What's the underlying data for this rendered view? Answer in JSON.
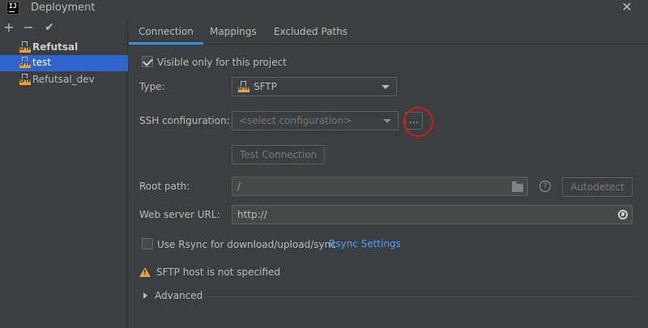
{
  "window": {
    "title": "Deployment",
    "logo_text": "IJ"
  },
  "toolbar": {
    "add": "+",
    "remove": "−",
    "check": "✔"
  },
  "tree": {
    "items": [
      {
        "label": "Refutsal",
        "bold": true,
        "icon_text": "SFTP"
      },
      {
        "label": "test",
        "selected": true,
        "icon_text": "SFTP"
      },
      {
        "label": "Refutsal_dev",
        "icon_text": "SFTP"
      }
    ]
  },
  "tabs": [
    {
      "label": "Connection",
      "active": true
    },
    {
      "label": "Mappings"
    },
    {
      "label": "Excluded Paths"
    }
  ],
  "connection": {
    "visible_only_label": "Visible only for this project",
    "visible_only_checked": true,
    "type_label": "Type:",
    "type_value": "SFTP",
    "type_icon_text": "SFTP",
    "ssh_label": "SSH configuration:",
    "ssh_placeholder": "<select configuration>",
    "ssh_browse": "...",
    "test_connection": "Test Connection",
    "root_path_label": "Root path:",
    "root_path_value": "/",
    "help_glyph": "?",
    "autodetect": "Autodetect",
    "web_url_label": "Web server URL:",
    "web_url_value": "http://",
    "rsync_label": "Use Rsync for download/upload/sync",
    "rsync_checked": false,
    "rsync_settings_link": "Rsync Settings",
    "warning_text": "SFTP host is not specified",
    "warning_glyph": "!",
    "advanced_label": "Advanced"
  },
  "colors": {
    "background": "#3c3f41",
    "selection": "#2f65ca",
    "accent_tab": "#4a88c7",
    "link": "#589df6",
    "warning": "#e8a33e",
    "annotation": "#d01a1a"
  }
}
